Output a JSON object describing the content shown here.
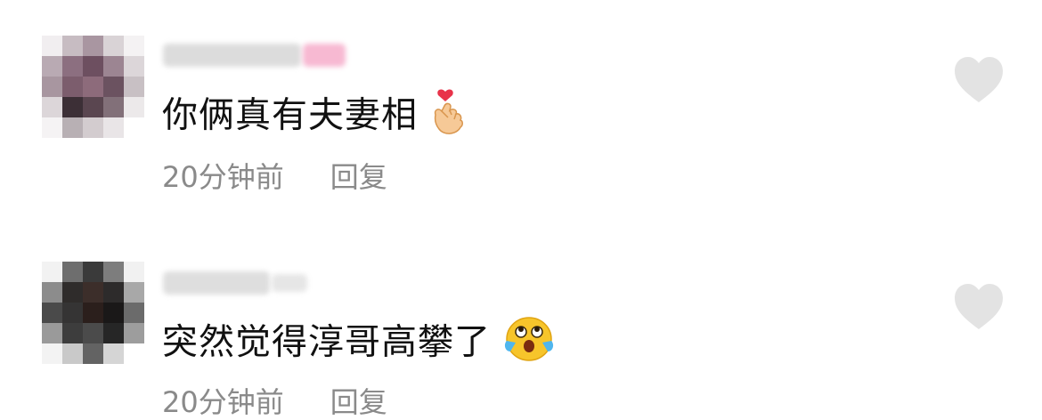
{
  "comments": [
    {
      "text": "你俩真有夫妻相",
      "emoji": "finger-heart-emoji",
      "time": "20分钟前",
      "reply": "回复"
    },
    {
      "text": "突然觉得淳哥高攀了",
      "emoji": "crying-laughing-emoji",
      "time": "20分钟前",
      "reply": "回复"
    }
  ],
  "icons": {
    "like": "heart-icon"
  },
  "colors": {
    "text": "#111111",
    "meta": "#8a8a8a",
    "like_icon": "#e3e3e3"
  }
}
